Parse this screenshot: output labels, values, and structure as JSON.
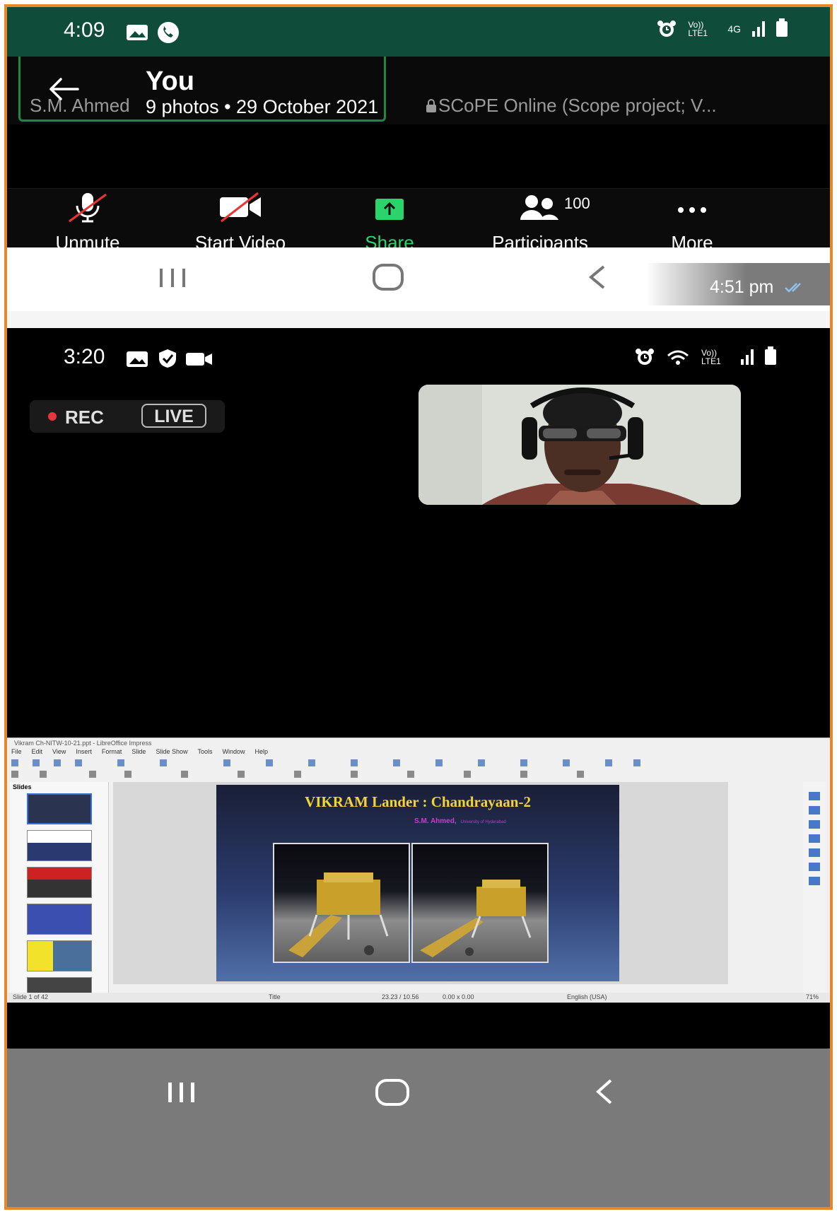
{
  "top_status": {
    "time": "4:09",
    "network_volte": "Vo)) LTE1",
    "network_gen": "4G"
  },
  "zoom_header": {
    "host_name": "S.M. Ahmed",
    "meeting_title": "SCoPE Online (Scope project; V...",
    "album_title": "You",
    "album_meta": "9 photos • 29 October 2021"
  },
  "zoom_toolbar": {
    "unmute": "Unmute",
    "start_video": "Start Video",
    "share": "Share",
    "participants": "Participants",
    "participants_count": "100",
    "more": "More"
  },
  "chat_timestamp": "4:51 pm",
  "second_status": {
    "time": "3:20",
    "network_volte": "Vo)) LTE1"
  },
  "recording": {
    "rec": "REC",
    "live": "LIVE"
  },
  "impress": {
    "window_title": "Vikram Ch-NITW-10-21.ppt - LibreOffice Impress",
    "menu": [
      "File",
      "Edit",
      "View",
      "Insert",
      "Format",
      "Slide",
      "Slide Show",
      "Tools",
      "Window",
      "Help"
    ],
    "slides_panel": "Slides",
    "slide_title": "VIKRAM Lander : Chandrayaan-2",
    "slide_author": "S.M. Ahmed,",
    "slide_affil": "University of Hyderabad",
    "status_slide": "Slide 1 of 42",
    "status_layout": "Title",
    "status_pos": "23.23 / 10.56",
    "status_size": "0.00 x 0.00",
    "status_lang": "English (USA)",
    "status_zoom": "71%"
  },
  "colors": {
    "status_bar": "#0f4d3a",
    "share_green": "#2bd46a",
    "rec_red": "#e8343c",
    "frame_orange": "#e8872a",
    "slide_title_yellow": "#f2d438"
  }
}
